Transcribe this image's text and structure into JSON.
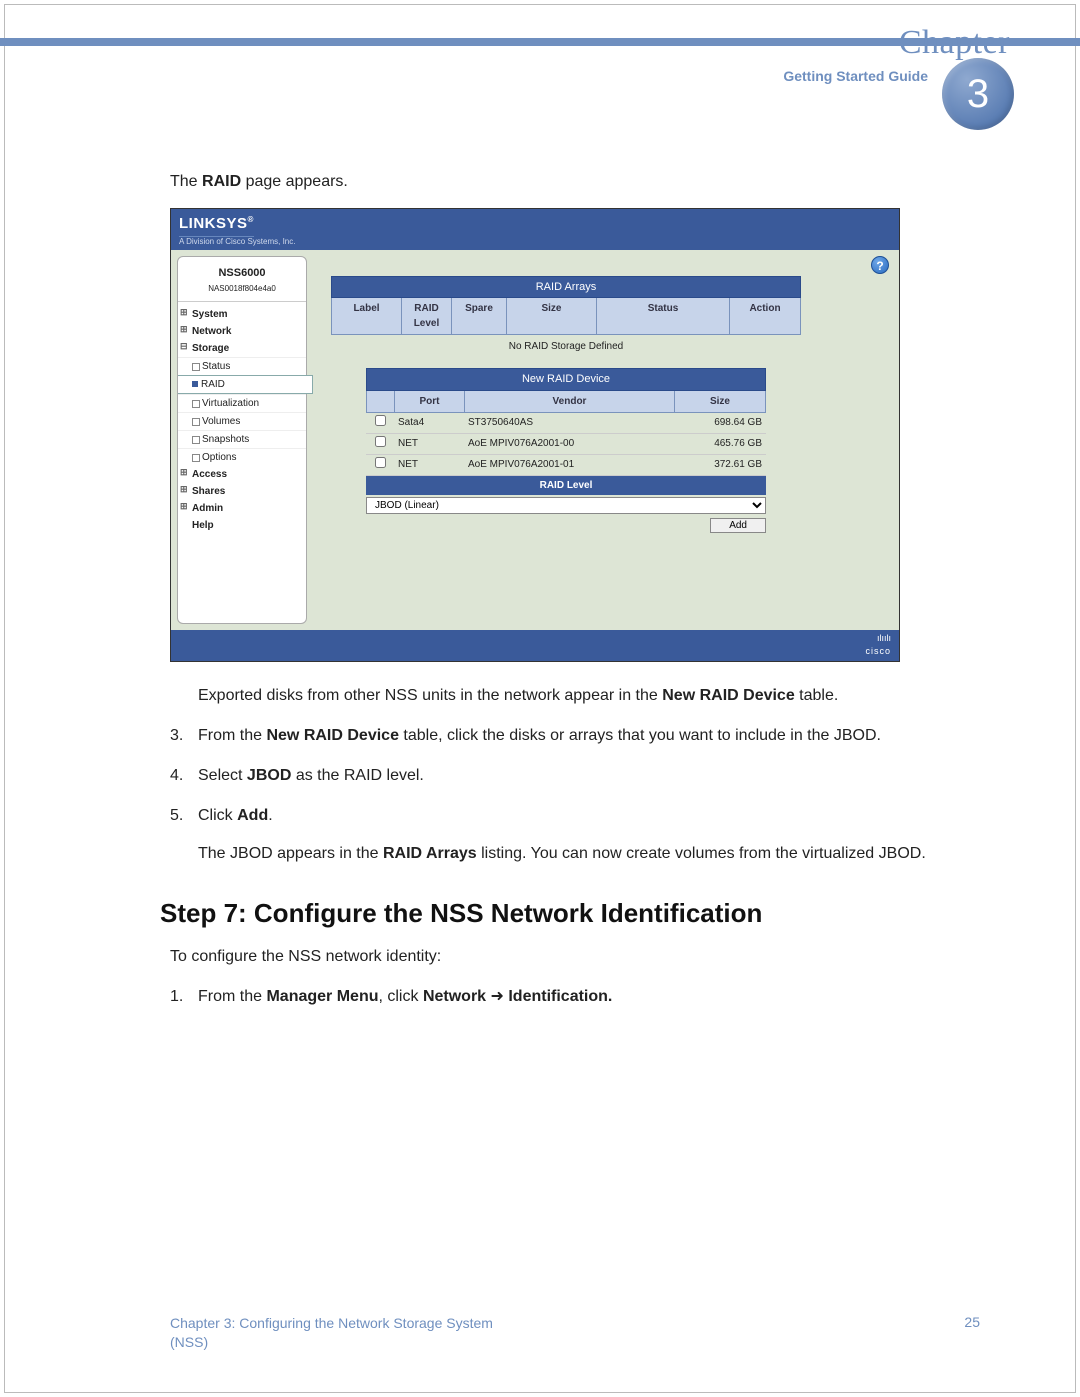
{
  "header": {
    "chapter_label": "Chapter",
    "guide_label": "Getting Started Guide",
    "chapter_number": "3"
  },
  "intro": {
    "text_prefix": "The ",
    "text_bold": "RAID",
    "text_suffix": " page appears."
  },
  "screenshot": {
    "logo": "LINKSYS",
    "logo_sup": "®",
    "logo_sub": "A Division of Cisco Systems, Inc.",
    "device_name": "NSS6000",
    "device_id": "NAS0018f804e4a0",
    "help_glyph": "?",
    "nav": {
      "system": "System",
      "network": "Network",
      "storage": "Storage",
      "status": "Status",
      "raid": "RAID",
      "virtualization": "Virtualization",
      "volumes": "Volumes",
      "snapshots": "Snapshots",
      "options": "Options",
      "access": "Access",
      "shares": "Shares",
      "admin": "Admin",
      "help": "Help"
    },
    "raid_arrays": {
      "title": "RAID Arrays",
      "cols": {
        "label": "Label",
        "level": "RAID Level",
        "spare": "Spare",
        "size": "Size",
        "status": "Status",
        "action": "Action"
      },
      "empty": "No RAID Storage Defined"
    },
    "new_device": {
      "title": "New RAID Device",
      "cols": {
        "port": "Port",
        "vendor": "Vendor",
        "size": "Size"
      },
      "rows": [
        {
          "port": "Sata4",
          "vendor": "ST3750640AS",
          "size": "698.64 GB"
        },
        {
          "port": "NET",
          "vendor": "AoE MPIV076A2001-00",
          "size": "465.76 GB"
        },
        {
          "port": "NET",
          "vendor": "AoE MPIV076A2001-01",
          "size": "372.61 GB"
        }
      ]
    },
    "raid_level_label": "RAID Level",
    "jbod_option": "JBOD (Linear)",
    "add_button": "Add",
    "footer_brand": "cisco"
  },
  "para_exported": {
    "prefix": "Exported disks from other NSS units in the network appear in the ",
    "bold": "New RAID Device",
    "suffix": " table."
  },
  "step3": {
    "num": "3.",
    "prefix": "From the ",
    "bold": "New RAID Device",
    "suffix": " table, click the disks or arrays that you want to include in the JBOD."
  },
  "step4": {
    "num": "4.",
    "prefix": "Select ",
    "bold": "JBOD",
    "suffix": " as the RAID level."
  },
  "step5": {
    "num": "5.",
    "prefix": "Click ",
    "bold": "Add",
    "suffix": ".",
    "sub_prefix": "The JBOD appears in the ",
    "sub_bold": "RAID Arrays",
    "sub_suffix": " listing. You can now create volumes from the virtualized JBOD."
  },
  "step7_heading": "Step 7: Configure the NSS Network Identification",
  "step7_intro": "To configure the NSS network identity:",
  "step7_1": {
    "num": "1.",
    "prefix": "From the ",
    "bold1": "Manager Menu",
    "mid": ", click ",
    "bold2": "Network",
    "arrow": " ➜ ",
    "bold3": "Identification."
  },
  "footer": {
    "left_line1": "Chapter 3: Configuring the Network Storage System",
    "left_line2": "(NSS)",
    "page_num": "25"
  }
}
